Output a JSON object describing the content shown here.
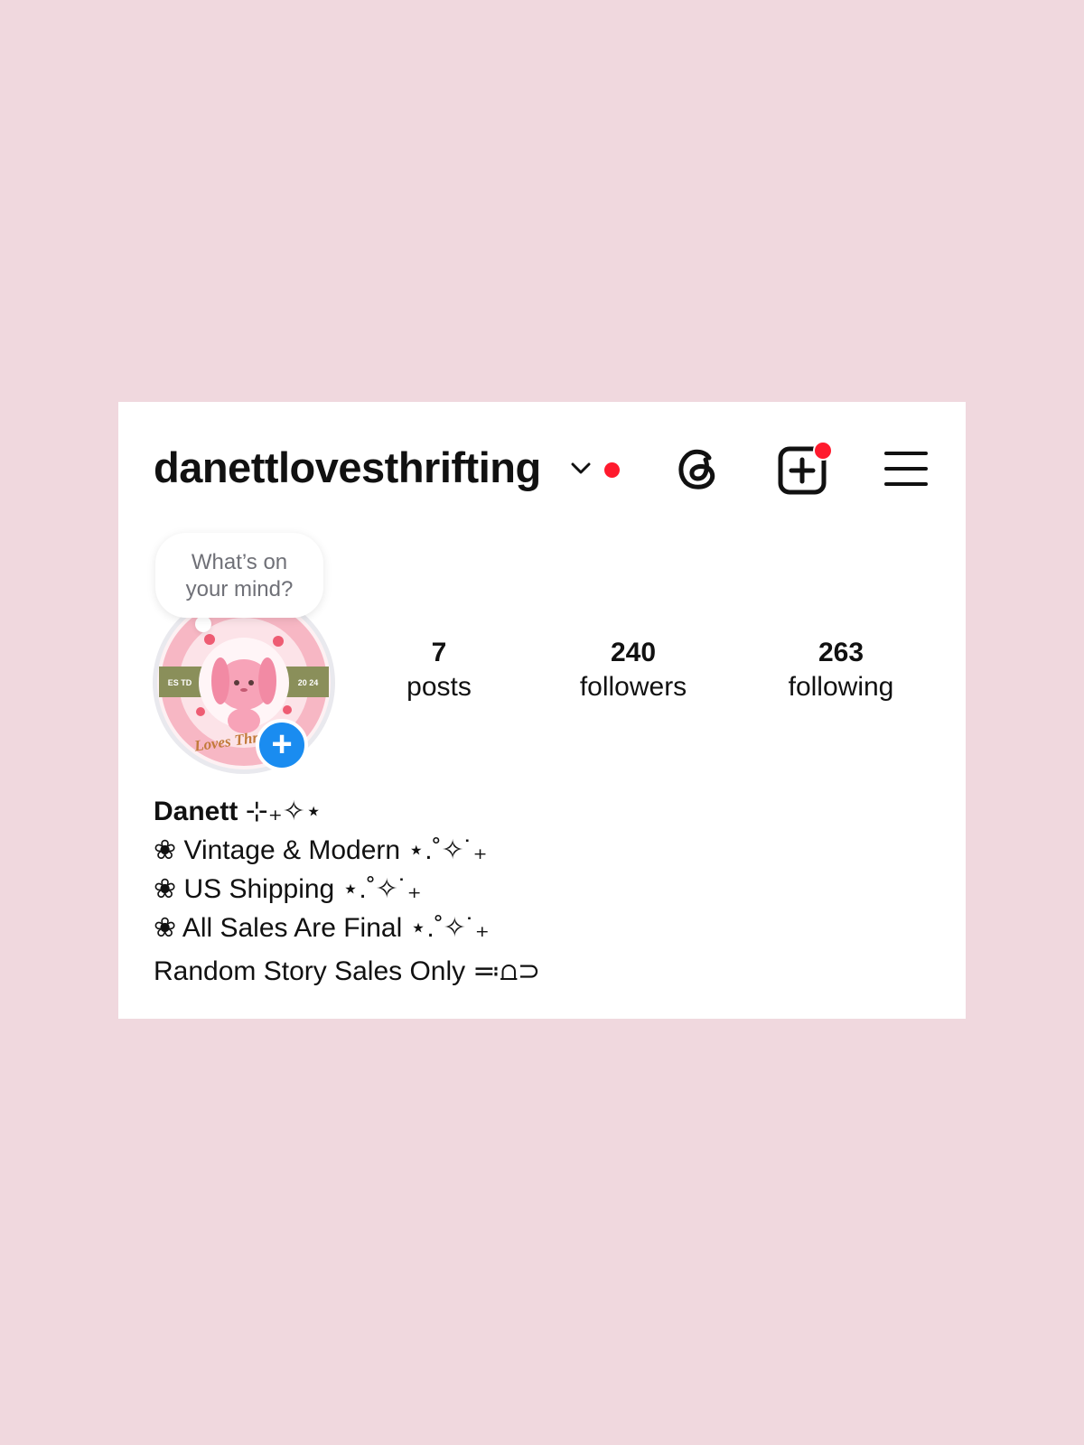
{
  "profile": {
    "username": "danettlovesthrifting",
    "prompt_bubble": {
      "line1": "What’s on",
      "line2": "your mind?"
    },
    "avatar": {
      "badge_left": "ES TD",
      "badge_right": "20 24",
      "caption": "Loves Thrifting"
    }
  },
  "stats": {
    "posts": {
      "value": "7",
      "label": "posts"
    },
    "followers": {
      "value": "240",
      "label": "followers"
    },
    "following": {
      "value": "263",
      "label": "following"
    }
  },
  "bio": {
    "name": "Danett",
    "name_decor": " ⊹₊✧⋆",
    "lines": [
      "❀ Vintage & Modern ⋆.˚✧˙₊",
      "❀ US Shipping ⋆.˚✧˙₊",
      "❀ All Sales Are Final ⋆.˚✧˙₊"
    ],
    "footer": "Random Story Sales Only ≕⩍⊃"
  },
  "icons": {
    "chevron": "chevron-down-icon",
    "threads": "threads-icon",
    "new_post": "plus-square-icon",
    "menu": "hamburger-menu-icon",
    "add_story": "plus-icon"
  },
  "colors": {
    "background": "#f0d8de",
    "card": "#ffffff",
    "notification": "#ff1a2d",
    "add_story": "#1a8cf0",
    "avatar_pink": "#f5a9b8",
    "avatar_olive": "#8a8f5a"
  }
}
